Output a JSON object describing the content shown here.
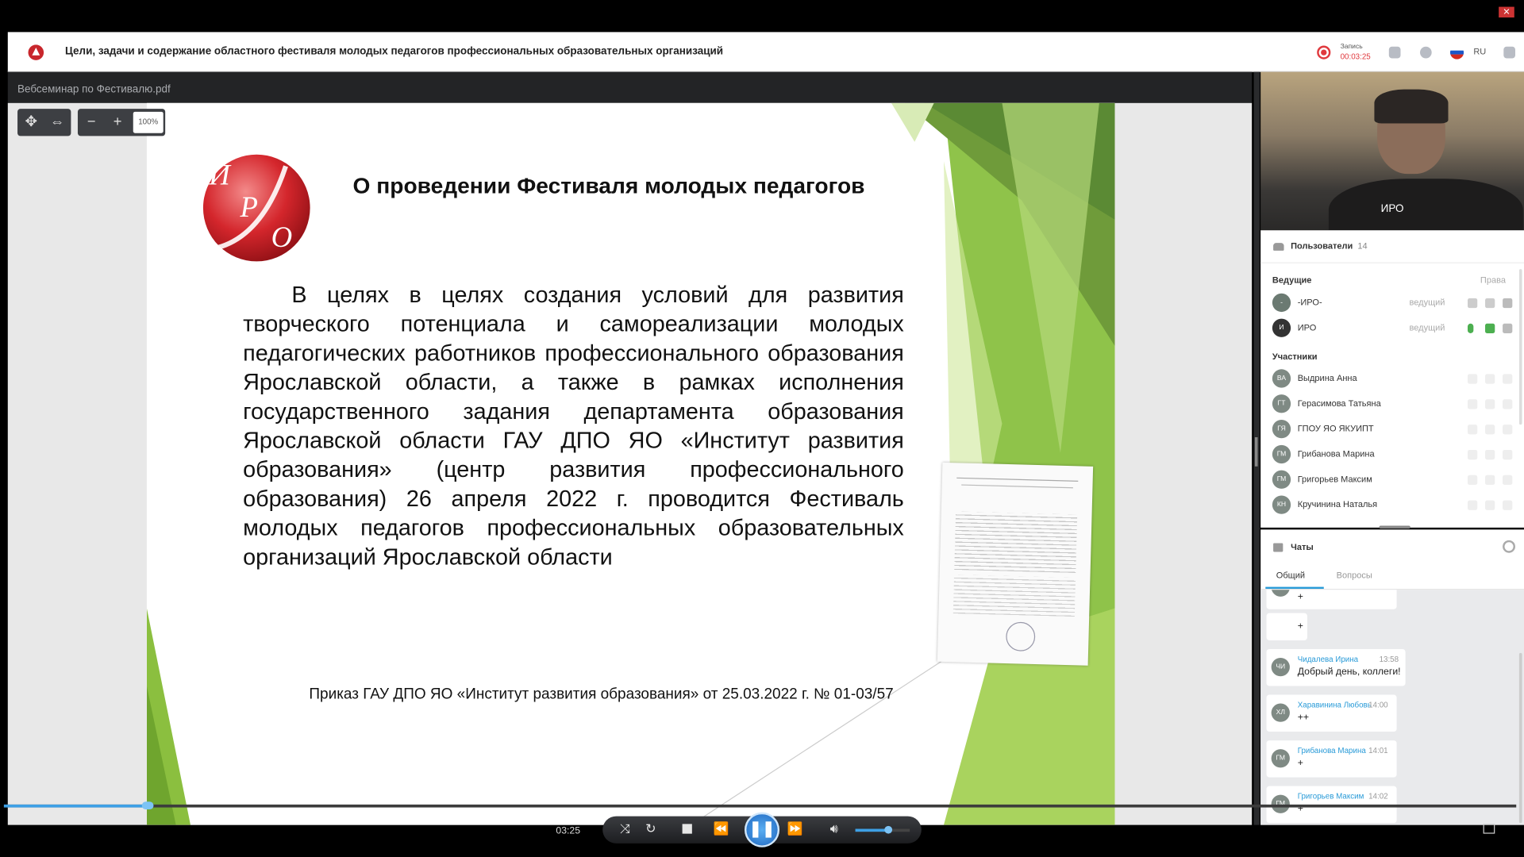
{
  "header": {
    "title": "Цели, задачи и содержание областного фестиваля молодых педагогов профессиональных образовательных организаций",
    "record_label": "Запись",
    "record_time": "00:03:25",
    "language": "RU"
  },
  "presentation": {
    "filename": "Вебсеминар по Фестивалю.pdf",
    "zoom": "100%",
    "slide": {
      "logo_text": "ИРО",
      "heading": "О проведении Фестиваля молодых педагогов",
      "body": "В целях в целях создания условий для развития творческого потенциала и самореализации молодых педагогических работников профессионального образования Ярославской области, а также в рамках исполнения государственного задания департамента образования Ярославской области ГАУ ДПО ЯО «Институт развития образования» (центр развития профессионального образования) 26 апреля 2022 г. проводится Фестиваль молодых педагогов профессиональных образовательных организаций Ярославской области",
      "footer": "Приказ ГАУ ДПО ЯО «Институт развития образования» от 25.03.2022 г. № 01-03/57"
    }
  },
  "video": {
    "name": "ИРО"
  },
  "users": {
    "title": "Пользователи",
    "count": "14",
    "rights_label": "Права",
    "presenters_label": "Ведущие",
    "participants_label": "Участники",
    "presenters": [
      {
        "initials": "-",
        "name": "-ИРО-",
        "role": "ведущий"
      },
      {
        "initials": "И",
        "name": "ИРО",
        "role": "ведущий"
      }
    ],
    "participants": [
      {
        "initials": "ВА",
        "name": "Выдрина Анна"
      },
      {
        "initials": "ГТ",
        "name": "Герасимова Татьяна"
      },
      {
        "initials": "ГЯ",
        "name": "ГПОУ ЯО ЯКУИПТ"
      },
      {
        "initials": "ГМ",
        "name": "Грибанова Марина"
      },
      {
        "initials": "ГМ",
        "name": "Григорьев Максим"
      },
      {
        "initials": "КН",
        "name": "Кручинина Наталья"
      }
    ]
  },
  "chat": {
    "title": "Чаты",
    "tabs": [
      "Общий",
      "Вопросы"
    ],
    "messages": [
      {
        "initials": "",
        "name": "",
        "time": "",
        "text": "+"
      },
      {
        "initials": "",
        "name": "",
        "time": "",
        "text": "+"
      },
      {
        "initials": "ЧИ",
        "name": "Чидалева Ирина",
        "time": "13:58",
        "text": "Добрый день, коллеги!"
      },
      {
        "initials": "ХЛ",
        "name": "Харавинина Любовь",
        "time": "14:00",
        "text": "++"
      },
      {
        "initials": "ГМ",
        "name": "Грибанова Марина",
        "time": "14:01",
        "text": "+"
      },
      {
        "initials": "ГМ",
        "name": "Григорьев Максим",
        "time": "14:02",
        "text": "+"
      }
    ]
  },
  "player": {
    "current_time": "03:25",
    "progress": 0.095,
    "volume": 0.6
  },
  "colors": {
    "accent": "#3ea0e5",
    "record": "#e0393e",
    "slide_green": "#7cb342"
  }
}
